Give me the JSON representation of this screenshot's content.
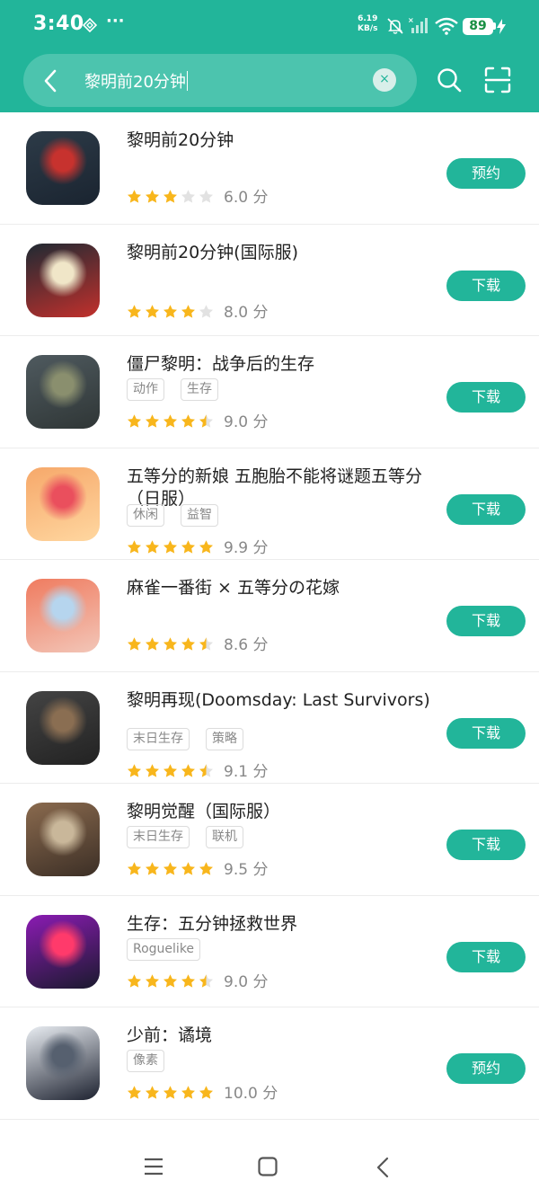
{
  "status_bar": {
    "time": "3:40",
    "net_speed_value": "6.19",
    "net_speed_unit": "KB/s",
    "battery": "89",
    "icons": [
      "diamond-icon",
      "more-dots-icon",
      "mute-icon",
      "signal-icon",
      "wifi-icon",
      "charging-icon"
    ]
  },
  "search": {
    "query": "黎明前20分钟",
    "clear_glyph": "×"
  },
  "colors": {
    "accent": "#22b59a",
    "star_filled": "#f8b61c",
    "star_empty": "#e2e2e2",
    "battery_text": "#1a8f43"
  },
  "apps": [
    {
      "title": "黎明前20分钟",
      "tags": [],
      "stars": 3,
      "score": "6.0 分",
      "action": "预约"
    },
    {
      "title": "黎明前20分钟(国际服)",
      "tags": [],
      "stars": 4,
      "score": "8.0 分",
      "action": "下载"
    },
    {
      "title": "僵尸黎明：战争后的生存",
      "tags": [
        "动作",
        "生存"
      ],
      "stars": 4.5,
      "score": "9.0 分",
      "action": "下载"
    },
    {
      "title": "五等分的新娘 五胞胎不能将谜题五等分（日服）",
      "tags": [
        "休闲",
        "益智"
      ],
      "stars": 5,
      "score": "9.9 分",
      "action": "下载"
    },
    {
      "title": "麻雀一番街 × 五等分の花嫁",
      "tags": [],
      "stars": 4.5,
      "score": "8.6 分",
      "action": "下载"
    },
    {
      "title": "黎明再现(Doomsday: Last Survivors)",
      "tags": [
        "末日生存",
        "策略"
      ],
      "stars": 4.5,
      "score": "9.1 分",
      "action": "下载"
    },
    {
      "title": "黎明觉醒（国际服）",
      "tags": [
        "末日生存",
        "联机"
      ],
      "stars": 5,
      "score": "9.5 分",
      "action": "下载"
    },
    {
      "title": "生存：五分钟拯救世界",
      "tags": [
        "Roguelike"
      ],
      "stars": 4.5,
      "score": "9.0 分",
      "action": "下载"
    },
    {
      "title": "少前：谲境",
      "tags": [
        "像素"
      ],
      "stars": 5,
      "score": "10.0 分",
      "action": "预约"
    }
  ],
  "nav_bar": {
    "icons": [
      "menu-icon",
      "home-icon",
      "back-icon"
    ]
  }
}
